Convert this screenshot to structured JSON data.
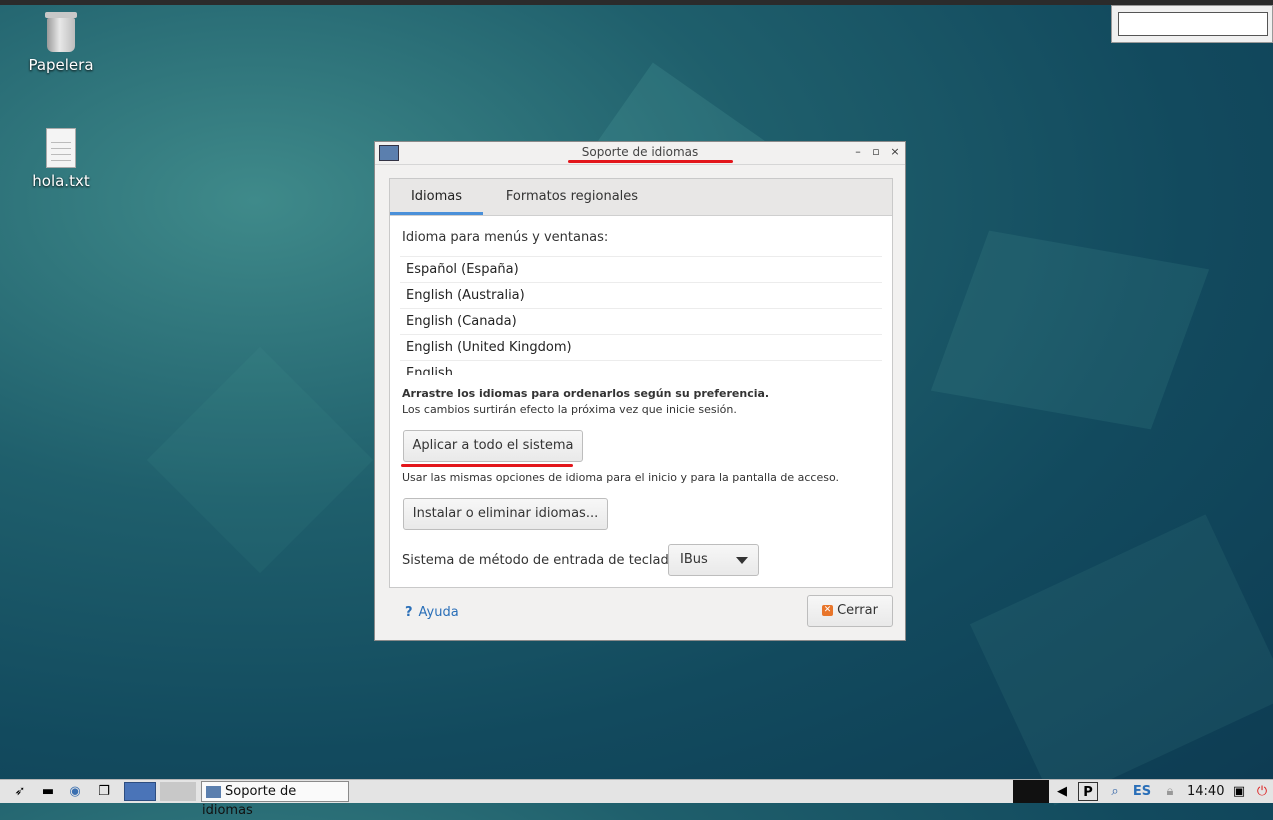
{
  "desktop": {
    "icons": [
      {
        "label": "Papelera"
      },
      {
        "label": "hola.txt"
      }
    ]
  },
  "window": {
    "title": "Soporte de idiomas",
    "controls": {
      "minimize": "–",
      "maximize": "▫",
      "close": "×"
    },
    "tabs": [
      {
        "label": "Idiomas",
        "active": true
      },
      {
        "label": "Formatos regionales",
        "active": false
      }
    ],
    "menu_lang_label": "Idioma para menús y ventanas:",
    "languages": [
      "Español (España)",
      "English (Australia)",
      "English (Canada)",
      "English (United Kingdom)",
      "English"
    ],
    "drag_note": "Arrastre los idiomas para ordenarlos según su preferencia.",
    "changes_note": "Los cambios surtirán efecto la próxima vez que inicie sesión.",
    "apply_button": "Aplicar a todo el sistema",
    "apply_note": "Usar las mismas opciones de idioma para el inicio y para la pantalla de acceso.",
    "install_button": "Instalar o eliminar idiomas...",
    "input_method_label": "Sistema de método de entrada de teclado:",
    "input_method_value": "IBus",
    "help_link": "Ayuda",
    "help_glyph": "?",
    "close_button": "Cerrar"
  },
  "taskbar": {
    "task_label": "Soporte de idiomas",
    "keyboard_layout": "ES",
    "clock": "14:40"
  },
  "colors": {
    "accent_tab": "#4a90d9",
    "annotation_red": "#e3161b",
    "link": "#2a6fb8"
  }
}
